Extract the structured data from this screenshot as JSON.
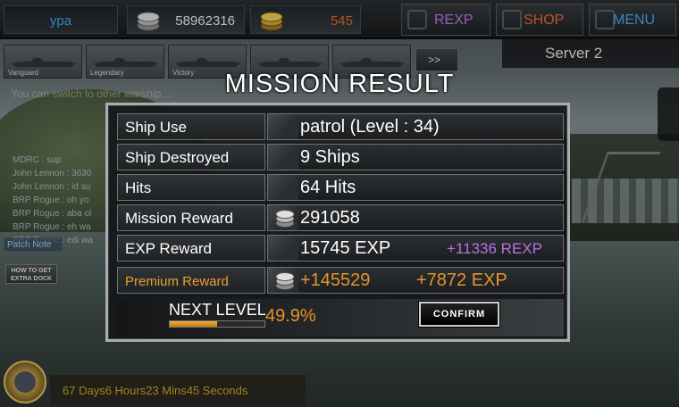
{
  "topbar": {
    "player_name": "ypa",
    "coins": "58962316",
    "gold": "545",
    "rexp_label": "REXP",
    "shop_label": "SHOP",
    "menu_label": "MENU"
  },
  "ships": [
    {
      "label": "Vanguard"
    },
    {
      "label": "Legendary"
    },
    {
      "label": "Victory"
    },
    {
      "label": ""
    },
    {
      "label": ""
    }
  ],
  "arrow_label": ">>",
  "server": {
    "label": "Server   2"
  },
  "hint": "You can switch to other warship...",
  "chat": [
    "MDRC : sup",
    "John Lennon : 3630",
    "John Lennon : id su",
    "BRP Rogue : oh yo",
    "BRP Rogue : aba ol",
    "BRP Rogue : eh wa",
    "BRP Rogue : edi wa"
  ],
  "patch_note": "Patch Note",
  "extra_dock": "HOW TO GET EXTRA DOCK",
  "timer": "67 Days6 Hours23 Mins45 Seconds",
  "result": {
    "title": "MISSION RESULT",
    "rows": [
      {
        "label": "Ship Use",
        "value": "patrol  (Level : 34)"
      },
      {
        "label": "Ship Destroyed",
        "value": "9  Ships"
      },
      {
        "label": "Hits",
        "value": "64  Hits"
      },
      {
        "label": "Mission Reward",
        "value": "291058"
      },
      {
        "label": "EXP Reward",
        "value": "15745  EXP",
        "extra": "+11336 REXP"
      },
      {
        "label": "Premium Reward",
        "value": "+145529",
        "extra": "+7872  EXP"
      }
    ],
    "next_level_label": "NEXT LEVEL",
    "next_level_pct": "49.9%",
    "next_level_fraction": 0.499,
    "confirm_label": "CONFIRM"
  },
  "colors": {
    "rexp": "#b872e8",
    "shop": "#e3643a",
    "menu": "#3ea6e8",
    "premium": "#e6932a"
  }
}
